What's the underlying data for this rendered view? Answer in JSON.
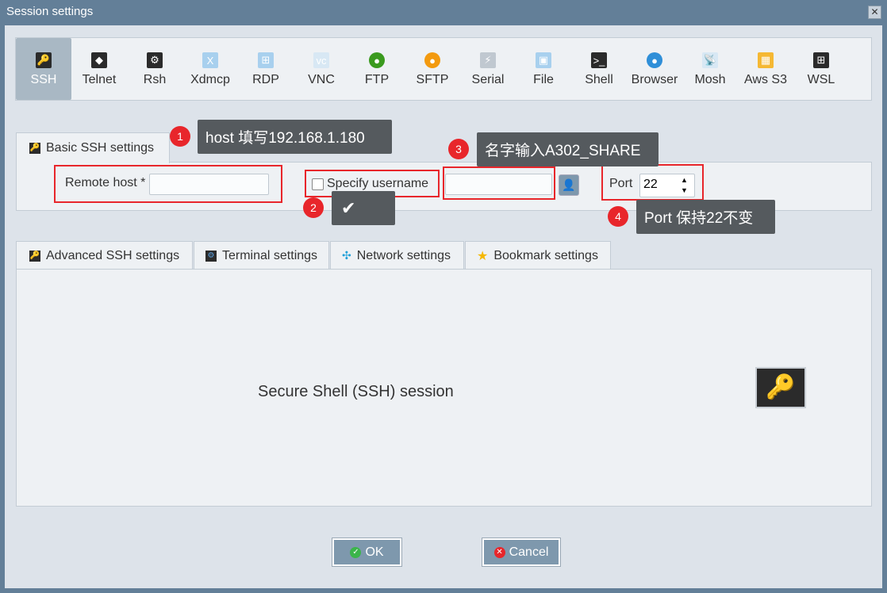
{
  "window": {
    "title": "Session settings",
    "close": "✕"
  },
  "toolbar": {
    "items": [
      {
        "label": "SSH",
        "icon": "key-icon",
        "glyph": "🔑",
        "bg": "#2b2b2b"
      },
      {
        "label": "Telnet",
        "icon": "telnet-gem-icon",
        "glyph": "◆",
        "bg": "#2b2b2b"
      },
      {
        "label": "Rsh",
        "icon": "rsh-gears-icon",
        "glyph": "⚙",
        "bg": "#2b2b2b"
      },
      {
        "label": "Xdmcp",
        "icon": "xdmcp-monitor-icon",
        "glyph": "X",
        "bg": "#a8d0ee"
      },
      {
        "label": "RDP",
        "icon": "rdp-monitor-icon",
        "glyph": "⊞",
        "bg": "#a8d0ee"
      },
      {
        "label": "VNC",
        "icon": "vnc-monitor-icon",
        "glyph": "vc",
        "bg": "#d8e8f4"
      },
      {
        "label": "FTP",
        "icon": "ftp-globe-icon",
        "glyph": "●",
        "bg": "#3a9a1e"
      },
      {
        "label": "SFTP",
        "icon": "sftp-globe-icon",
        "glyph": "●",
        "bg": "#f39a0f"
      },
      {
        "label": "Serial",
        "icon": "serial-plug-icon",
        "glyph": "⚡",
        "bg": "#c0c8d0"
      },
      {
        "label": "File",
        "icon": "file-monitor-icon",
        "glyph": "▣",
        "bg": "#a8d0ee"
      },
      {
        "label": "Shell",
        "icon": "shell-terminal-icon",
        "glyph": ">_",
        "bg": "#2b2b2b"
      },
      {
        "label": "Browser",
        "icon": "browser-globe-icon",
        "glyph": "●",
        "bg": "#2f8fd8"
      },
      {
        "label": "Mosh",
        "icon": "mosh-satellite-icon",
        "glyph": "📡",
        "bg": "#d8e8f4"
      },
      {
        "label": "Aws S3",
        "icon": "aws-s3-cubes-icon",
        "glyph": "▦",
        "bg": "#f5b833"
      },
      {
        "label": "WSL",
        "icon": "wsl-windows-icon",
        "glyph": "⊞",
        "bg": "#2b2b2b"
      }
    ]
  },
  "basic": {
    "tab": "Basic SSH settings",
    "remote_host_label": "Remote host *",
    "remote_host_value": "",
    "specify_username": "Specify username",
    "username_value": "",
    "port_label": "Port",
    "port_value": "22"
  },
  "subtabs": [
    {
      "label": "Advanced SSH settings"
    },
    {
      "label": "Terminal settings"
    },
    {
      "label": "Network settings"
    },
    {
      "label": "Bookmark settings"
    }
  ],
  "session_description": "Secure Shell (SSH) session",
  "buttons": {
    "ok": "OK",
    "cancel": "Cancel"
  },
  "annotations": [
    {
      "num": "1",
      "text": "host 填写192.168.1.180"
    },
    {
      "num": "2",
      "text": "✔"
    },
    {
      "num": "3",
      "text": "名字输入A302_SHARE"
    },
    {
      "num": "4",
      "text": "Port 保持22不变"
    }
  ],
  "colors": {
    "annotation_red": "#e8262b",
    "tooltip_bg": "#555a5e",
    "selected_tool": "#a9b8c4"
  }
}
